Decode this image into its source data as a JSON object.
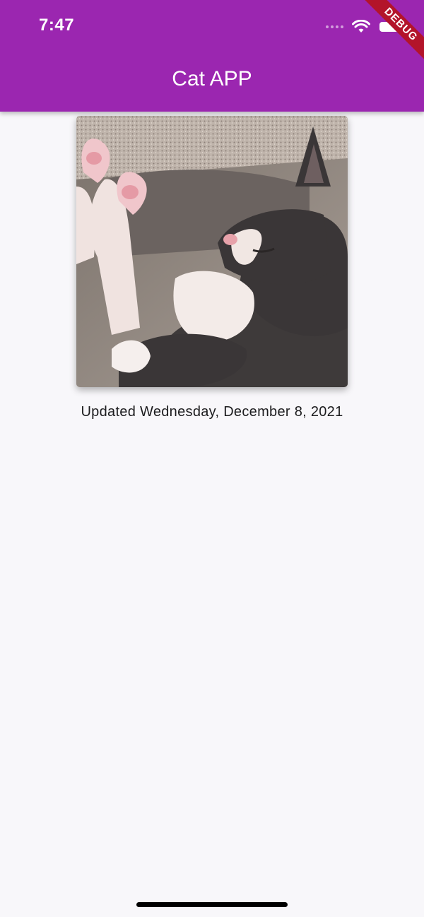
{
  "status_bar": {
    "time": "7:47",
    "icons": [
      "signal-dots-icon",
      "wifi-icon",
      "battery-icon"
    ]
  },
  "debug_banner": {
    "label": "DEBUG"
  },
  "app_bar": {
    "title": "Cat APP",
    "color": "#9b26b0"
  },
  "content": {
    "image": {
      "subject": "gray and white kitten stretching its paws"
    },
    "updated_text": "Updated Wednesday, December 8, 2021"
  }
}
